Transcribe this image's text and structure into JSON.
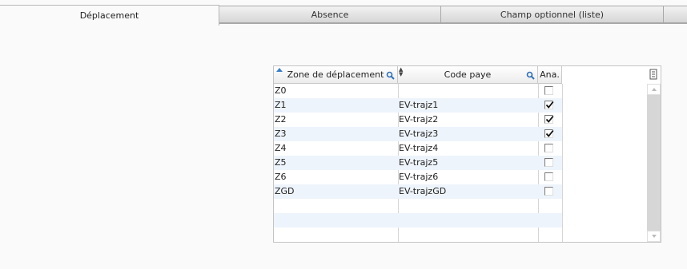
{
  "tabs": [
    {
      "label": "Déplacement",
      "active": true
    },
    {
      "label": "Absence",
      "active": false
    },
    {
      "label": "Champ optionnel (liste)",
      "active": false
    }
  ],
  "grid": {
    "columns": [
      "Zone de déplacement",
      "Code paye",
      "Ana."
    ],
    "rows": [
      {
        "zone": "Z0",
        "code": "",
        "ana": false
      },
      {
        "zone": "Z1",
        "code": "EV-trajz1",
        "ana": true
      },
      {
        "zone": "Z2",
        "code": "EV-trajz2",
        "ana": true
      },
      {
        "zone": "Z3",
        "code": "EV-trajz3",
        "ana": true
      },
      {
        "zone": "Z4",
        "code": "EV-trajz4",
        "ana": false
      },
      {
        "zone": "Z5",
        "code": "EV-trajz5",
        "ana": false
      },
      {
        "zone": "Z6",
        "code": "EV-trajz6",
        "ana": false
      },
      {
        "zone": "ZGD",
        "code": "EV-trajzGD",
        "ana": false
      }
    ],
    "empty_rows": 2
  },
  "colors": {
    "accent": "#3a7ec8",
    "row_alt": "#eef4fb"
  },
  "icons": [
    "search-icon",
    "sort-ascending-icon",
    "sort-icon",
    "column-menu-icon",
    "scroll-up-icon",
    "scroll-down-icon"
  ]
}
